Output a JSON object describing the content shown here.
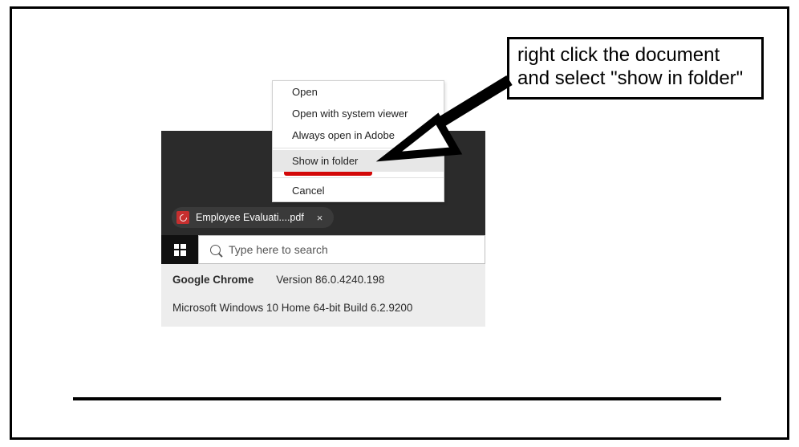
{
  "callout": {
    "text": "right click the document and select \"show in folder\""
  },
  "context_menu": {
    "items": [
      {
        "label": "Open"
      },
      {
        "label": "Open with system viewer"
      },
      {
        "label": "Always open in Adobe"
      },
      {
        "label": "Show in folder",
        "highlighted": true
      },
      {
        "label": "Cancel"
      }
    ]
  },
  "download": {
    "filename": "Employee Evaluati....pdf"
  },
  "taskbar": {
    "search_placeholder": "Type here to search"
  },
  "system_info": {
    "browser_name": "Google Chrome",
    "browser_version": "Version 86.0.4240.198",
    "os_line": "Microsoft Windows 10 Home 64-bit Build 6.2.9200"
  }
}
